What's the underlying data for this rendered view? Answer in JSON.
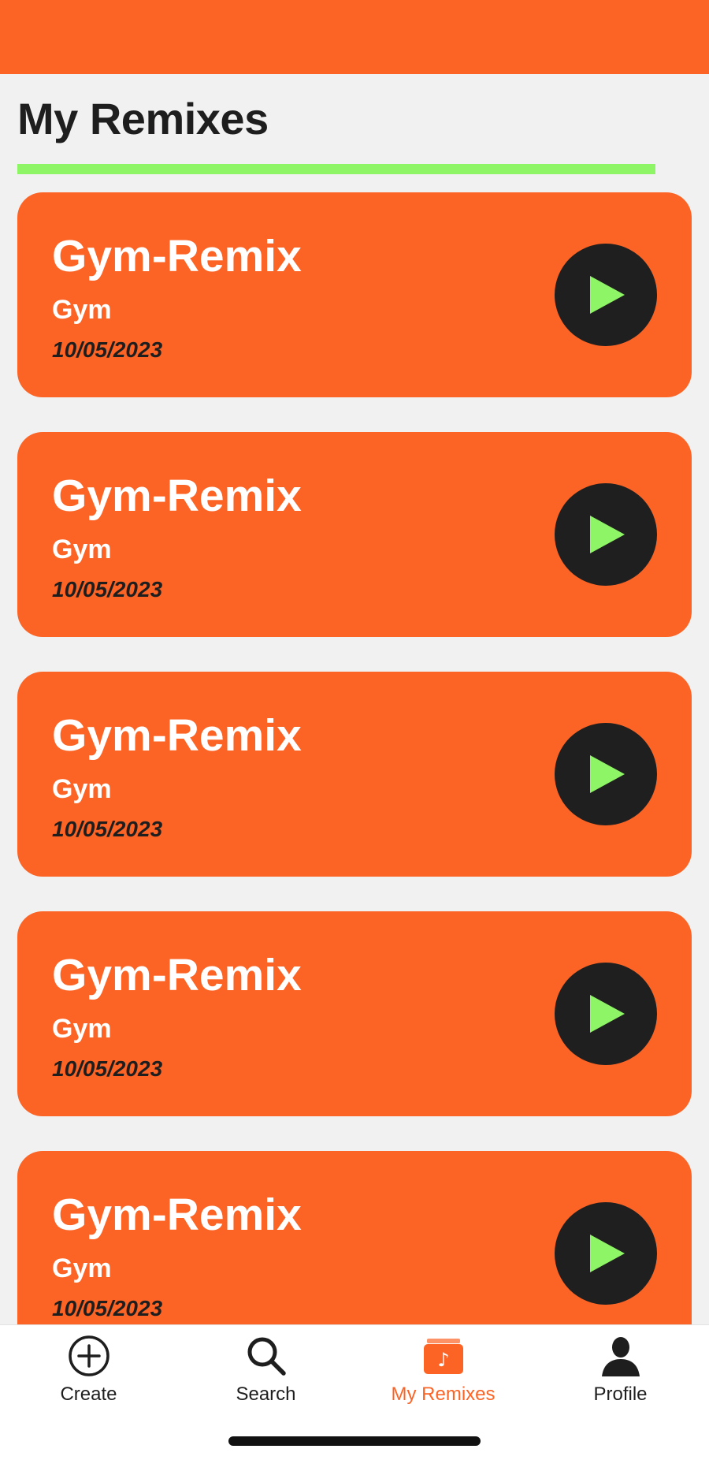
{
  "header": {
    "title": "My Remixes"
  },
  "colors": {
    "accent": "#fc6425",
    "highlight": "#8ef566",
    "dark": "#1f1f1f",
    "background": "#f2f1f2"
  },
  "remixes": [
    {
      "title": "Gym-Remix",
      "category": "Gym",
      "date": "10/05/2023",
      "icon": "play-icon"
    },
    {
      "title": "Gym-Remix",
      "category": "Gym",
      "date": "10/05/2023",
      "icon": "play-icon"
    },
    {
      "title": "Gym-Remix",
      "category": "Gym",
      "date": "10/05/2023",
      "icon": "play-icon"
    },
    {
      "title": "Gym-Remix",
      "category": "Gym",
      "date": "10/05/2023",
      "icon": "play-icon"
    },
    {
      "title": "Gym-Remix",
      "category": "Gym",
      "date": "10/05/2023",
      "icon": "play-icon"
    }
  ],
  "tabbar": {
    "items": [
      {
        "label": "Create",
        "icon": "plus-circle-icon",
        "active": false
      },
      {
        "label": "Search",
        "icon": "search-icon",
        "active": false
      },
      {
        "label": "My Remixes",
        "icon": "music-folder-icon",
        "active": true
      },
      {
        "label": "Profile",
        "icon": "person-icon",
        "active": false
      }
    ]
  }
}
